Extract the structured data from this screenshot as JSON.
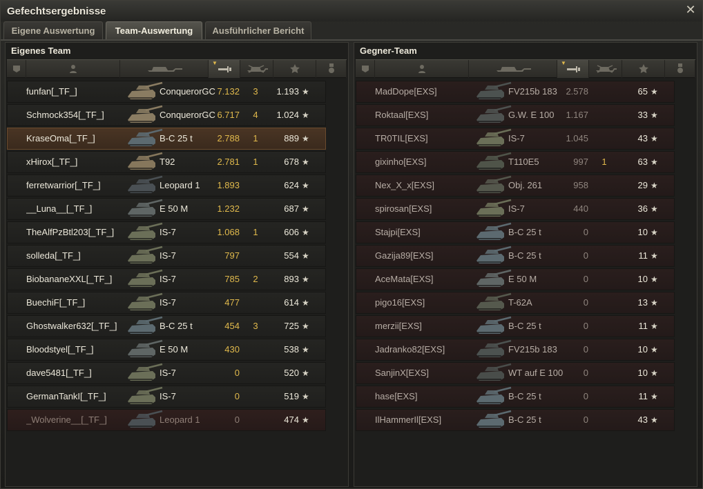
{
  "window": {
    "title": "Gefechtsergebnisse"
  },
  "tabs": [
    {
      "label": "Eigene Auswertung"
    },
    {
      "label": "Team-Auswertung"
    },
    {
      "label": "Ausführlicher Bericht"
    }
  ],
  "own_team": {
    "title": "Eigenes Team",
    "rows": [
      {
        "name": "funfan[_TF_]",
        "tank": "ConquerorGC",
        "damage": "7.132",
        "kills": "3",
        "xp": "1.193"
      },
      {
        "name": "Schmock354[_TF_]",
        "tank": "ConquerorGC",
        "damage": "6.717",
        "kills": "4",
        "xp": "1.024"
      },
      {
        "name": "KraseOma[_TF_]",
        "tank": "B-C 25 t",
        "damage": "2.788",
        "kills": "1",
        "xp": "889"
      },
      {
        "name": "xHirox[_TF_]",
        "tank": "T92",
        "damage": "2.781",
        "kills": "1",
        "xp": "678"
      },
      {
        "name": "ferretwarrior[_TF_]",
        "tank": "Leopard 1",
        "damage": "1.893",
        "kills": "",
        "xp": "624"
      },
      {
        "name": "__Luna__[_TF_]",
        "tank": "E 50 M",
        "damage": "1.232",
        "kills": "",
        "xp": "687"
      },
      {
        "name": "TheAlfPzBtl203[_TF_]",
        "tank": "IS-7",
        "damage": "1.068",
        "kills": "1",
        "xp": "606"
      },
      {
        "name": "solleda[_TF_]",
        "tank": "IS-7",
        "damage": "797",
        "kills": "",
        "xp": "554"
      },
      {
        "name": "BiobananeXXL[_TF_]",
        "tank": "IS-7",
        "damage": "785",
        "kills": "2",
        "xp": "893"
      },
      {
        "name": "BuechiF[_TF_]",
        "tank": "IS-7",
        "damage": "477",
        "kills": "",
        "xp": "614"
      },
      {
        "name": "Ghostwalker632[_TF_]",
        "tank": "B-C 25 t",
        "damage": "454",
        "kills": "3",
        "xp": "725"
      },
      {
        "name": "Bloodstyel[_TF_]",
        "tank": "E 50 M",
        "damage": "430",
        "kills": "",
        "xp": "538"
      },
      {
        "name": "dave5481[_TF_]",
        "tank": "IS-7",
        "damage": "0",
        "kills": "",
        "xp": "520"
      },
      {
        "name": "GermanTankI[_TF_]",
        "tank": "IS-7",
        "damage": "0",
        "kills": "",
        "xp": "519"
      },
      {
        "name": "_Wolverine__[_TF_]",
        "tank": "Leopard 1",
        "damage": "0",
        "kills": "",
        "xp": "474"
      }
    ]
  },
  "enemy_team": {
    "title": "Gegner-Team",
    "rows": [
      {
        "name": "MadDope[EXS]",
        "tank": "FV215b 183",
        "damage": "2.578",
        "kills": "",
        "xp": "65"
      },
      {
        "name": "Roktaal[EXS]",
        "tank": "G.W. E 100",
        "damage": "1.167",
        "kills": "",
        "xp": "33"
      },
      {
        "name": "TR0TIL[EXS]",
        "tank": "IS-7",
        "damage": "1.045",
        "kills": "",
        "xp": "43"
      },
      {
        "name": "gixinho[EXS]",
        "tank": "T110E5",
        "damage": "997",
        "kills": "1",
        "xp": "63"
      },
      {
        "name": "Nex_X_x[EXS]",
        "tank": "Obj. 261",
        "damage": "958",
        "kills": "",
        "xp": "29"
      },
      {
        "name": "spirosan[EXS]",
        "tank": "IS-7",
        "damage": "440",
        "kills": "",
        "xp": "36"
      },
      {
        "name": "Stajpi[EXS]",
        "tank": "B-C 25 t",
        "damage": "0",
        "kills": "",
        "xp": "10"
      },
      {
        "name": "Gazija89[EXS]",
        "tank": "B-C 25 t",
        "damage": "0",
        "kills": "",
        "xp": "11"
      },
      {
        "name": "AceMata[EXS]",
        "tank": "E 50 M",
        "damage": "0",
        "kills": "",
        "xp": "10"
      },
      {
        "name": "pigo16[EXS]",
        "tank": "T-62A",
        "damage": "0",
        "kills": "",
        "xp": "13"
      },
      {
        "name": "merzii[EXS]",
        "tank": "B-C 25 t",
        "damage": "0",
        "kills": "",
        "xp": "11"
      },
      {
        "name": "Jadranko82[EXS]",
        "tank": "FV215b 183",
        "damage": "0",
        "kills": "",
        "xp": "10"
      },
      {
        "name": "SanjinX[EXS]",
        "tank": "WT auf E 100",
        "damage": "0",
        "kills": "",
        "xp": "10"
      },
      {
        "name": "hase[EXS]",
        "tank": "B-C 25 t",
        "damage": "0",
        "kills": "",
        "xp": "11"
      },
      {
        "name": "IlHammerIl[EXS]",
        "tank": "B-C 25 t",
        "damage": "0",
        "kills": "",
        "xp": "43"
      }
    ]
  },
  "columns": [
    {
      "icon": "platoon-icon"
    },
    {
      "icon": "player-icon"
    },
    {
      "icon": "tank-icon"
    },
    {
      "icon": "damage-icon"
    },
    {
      "icon": "kills-icon"
    },
    {
      "icon": "xp-star-icon"
    },
    {
      "icon": "medal-icon"
    }
  ],
  "colors": {
    "accent_gold": "#e0b94c",
    "highlight_row": "#4a3524",
    "enemy_row": "#2a1e1d"
  }
}
